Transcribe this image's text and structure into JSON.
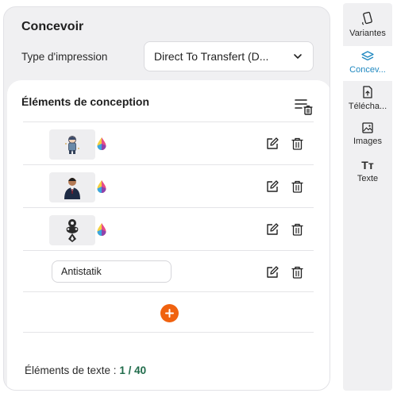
{
  "panel": {
    "title": "Concevoir",
    "print_type_label": "Type d'impression",
    "print_type_value": "Direct To Transfert (D..."
  },
  "design": {
    "title": "Éléments de conception",
    "text_element_value": "Antistatik",
    "counter_label": "Éléments de texte : ",
    "counter_value": "1 / 40",
    "add_symbol": "+"
  },
  "sidebar": {
    "items": [
      {
        "label": "Variantes",
        "icon": "phone-rotate-icon"
      },
      {
        "label": "Concev...",
        "icon": "layers-icon"
      },
      {
        "label": "Télécha...",
        "icon": "file-upload-icon"
      },
      {
        "label": "Images",
        "icon": "image-icon"
      },
      {
        "label": "Texte",
        "icon": "text-icon",
        "glyph": "Tт"
      }
    ]
  },
  "colors": {
    "accent": "#f0620f",
    "active_blue": "#1f88c0",
    "counter_green": "#1f6b4a"
  }
}
